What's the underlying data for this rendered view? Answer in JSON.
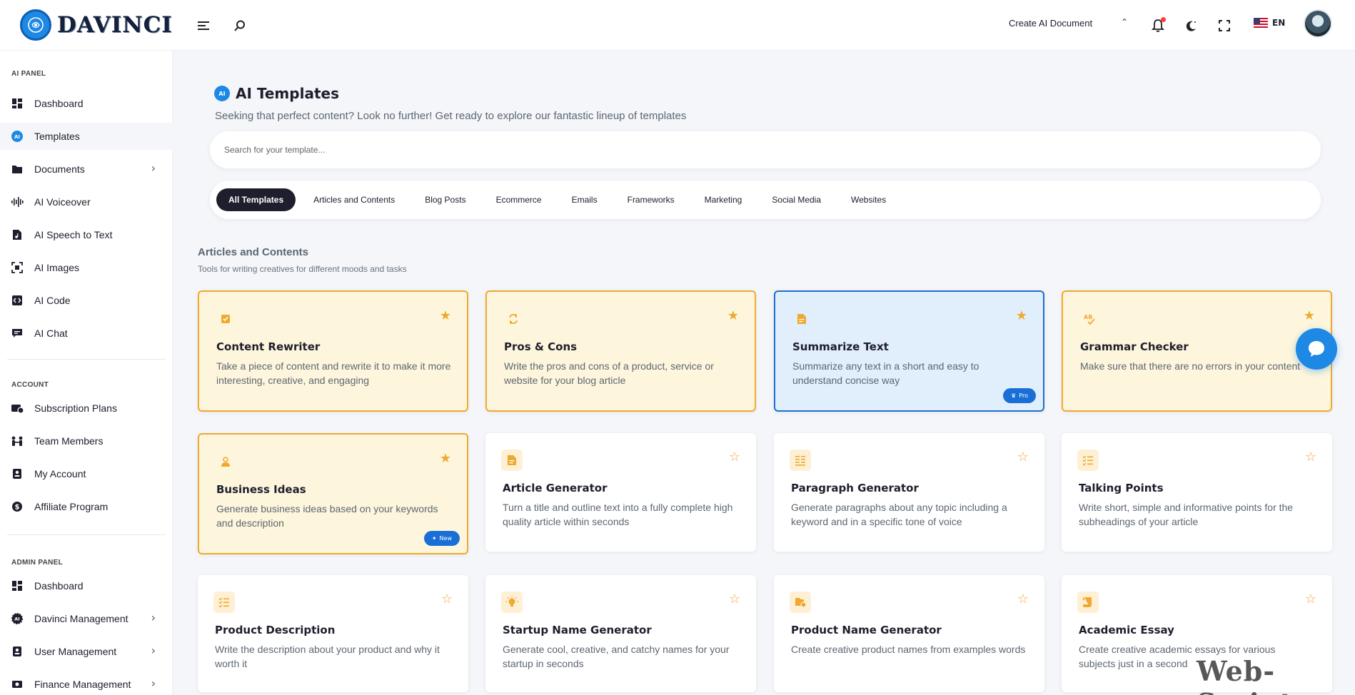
{
  "header": {
    "logo_text": "DAVINCI",
    "create_label": "Create AI Document",
    "lang": "EN"
  },
  "sidebar": {
    "sections": [
      {
        "title": "AI PANEL"
      },
      {
        "title": "ACCOUNT"
      },
      {
        "title": "ADMIN PANEL"
      }
    ],
    "ai_panel": [
      {
        "label": "Dashboard",
        "icon": "dashboard-icon"
      },
      {
        "label": "Templates",
        "icon": "ai-templates-icon",
        "active": true
      },
      {
        "label": "Documents",
        "icon": "folder-icon",
        "chevron": true
      },
      {
        "label": "AI Voiceover",
        "icon": "waveform-icon"
      },
      {
        "label": "AI Speech to Text",
        "icon": "music-file-icon"
      },
      {
        "label": "AI Images",
        "icon": "image-scan-icon"
      },
      {
        "label": "AI Code",
        "icon": "code-icon"
      },
      {
        "label": "AI Chat",
        "icon": "chat-icon"
      }
    ],
    "account": [
      {
        "label": "Subscription Plans",
        "icon": "subscription-icon"
      },
      {
        "label": "Team Members",
        "icon": "team-icon"
      },
      {
        "label": "My Account",
        "icon": "user-card-icon"
      },
      {
        "label": "Affiliate Program",
        "icon": "dollar-icon"
      }
    ],
    "admin": [
      {
        "label": "Dashboard",
        "icon": "dashboard-icon"
      },
      {
        "label": "Davinci Management",
        "icon": "ai-gear-icon",
        "chevron": true
      },
      {
        "label": "User Management",
        "icon": "user-card-icon",
        "chevron": true
      },
      {
        "label": "Finance Management",
        "icon": "finance-icon",
        "chevron": true
      }
    ]
  },
  "main": {
    "title": "AI Templates",
    "ai_badge": "AI",
    "subtitle": "Seeking that perfect content? Look no further! Get ready to explore our fantastic lineup of templates",
    "search_placeholder": "Search for your template...",
    "tabs": [
      "All Templates",
      "Articles and Contents",
      "Blog Posts",
      "Ecommerce",
      "Emails",
      "Frameworks",
      "Marketing",
      "Social Media",
      "Websites"
    ],
    "section_title": "Articles and Contents",
    "section_subtitle": "Tools for writing creatives for different moods and tasks",
    "cards": [
      {
        "title": "Content Rewriter",
        "desc": "Take a piece of content and rewrite it to make it more interesting, creative, and engaging",
        "variant": "yellow",
        "favorite": true,
        "icon": "checkbox-icon"
      },
      {
        "title": "Pros & Cons",
        "desc": "Write the pros and cons of a product, service or website for your blog article",
        "variant": "yellow",
        "favorite": true,
        "icon": "swap-icon"
      },
      {
        "title": "Summarize Text",
        "desc": "Summarize any text in a short and easy to understand concise way",
        "variant": "blue",
        "favorite": true,
        "icon": "document-icon",
        "pill": "Pro"
      },
      {
        "title": "Grammar Checker",
        "desc": "Make sure that there are no errors in your content",
        "variant": "yellow",
        "favorite": true,
        "icon": "spellcheck-icon"
      },
      {
        "title": "Business Ideas",
        "desc": "Generate business ideas based on your keywords and description",
        "variant": "yellow",
        "favorite": true,
        "icon": "person-icon",
        "pill": "New"
      },
      {
        "title": "Article Generator",
        "desc": "Turn a title and outline text into a fully complete high quality article within seconds",
        "variant": "plain",
        "favorite": false,
        "icon": "document-icon"
      },
      {
        "title": "Paragraph Generator",
        "desc": "Generate paragraphs about any topic including a keyword and in a specific tone of voice",
        "variant": "plain",
        "favorite": false,
        "icon": "paragraph-icon"
      },
      {
        "title": "Talking Points",
        "desc": "Write short, simple and informative points for the subheadings of your article",
        "variant": "plain",
        "favorite": false,
        "icon": "checklist-icon"
      },
      {
        "title": "Product Description",
        "desc": "Write the description about your product and why it worth it",
        "variant": "plain",
        "favorite": false,
        "icon": "checklist-icon"
      },
      {
        "title": "Startup Name Generator",
        "desc": "Generate cool, creative, and catchy names for your startup in seconds",
        "variant": "plain",
        "favorite": false,
        "icon": "lightbulb-icon"
      },
      {
        "title": "Product Name Generator",
        "desc": "Create creative product names from examples words",
        "variant": "plain",
        "favorite": false,
        "icon": "product-icon"
      },
      {
        "title": "Academic Essay",
        "desc": "Create creative academic essays for various subjects just in a second",
        "variant": "plain",
        "favorite": false,
        "icon": "scroll-icon"
      }
    ]
  },
  "watermark": "Web-Script",
  "colors": {
    "accent": "#1e88e5",
    "yellow_border": "#f0a92f",
    "yellow_bg": "#fef6dc",
    "blue_border": "#1e6fd0",
    "blue_bg": "#e1eefb",
    "dark": "#1e1e2d"
  }
}
